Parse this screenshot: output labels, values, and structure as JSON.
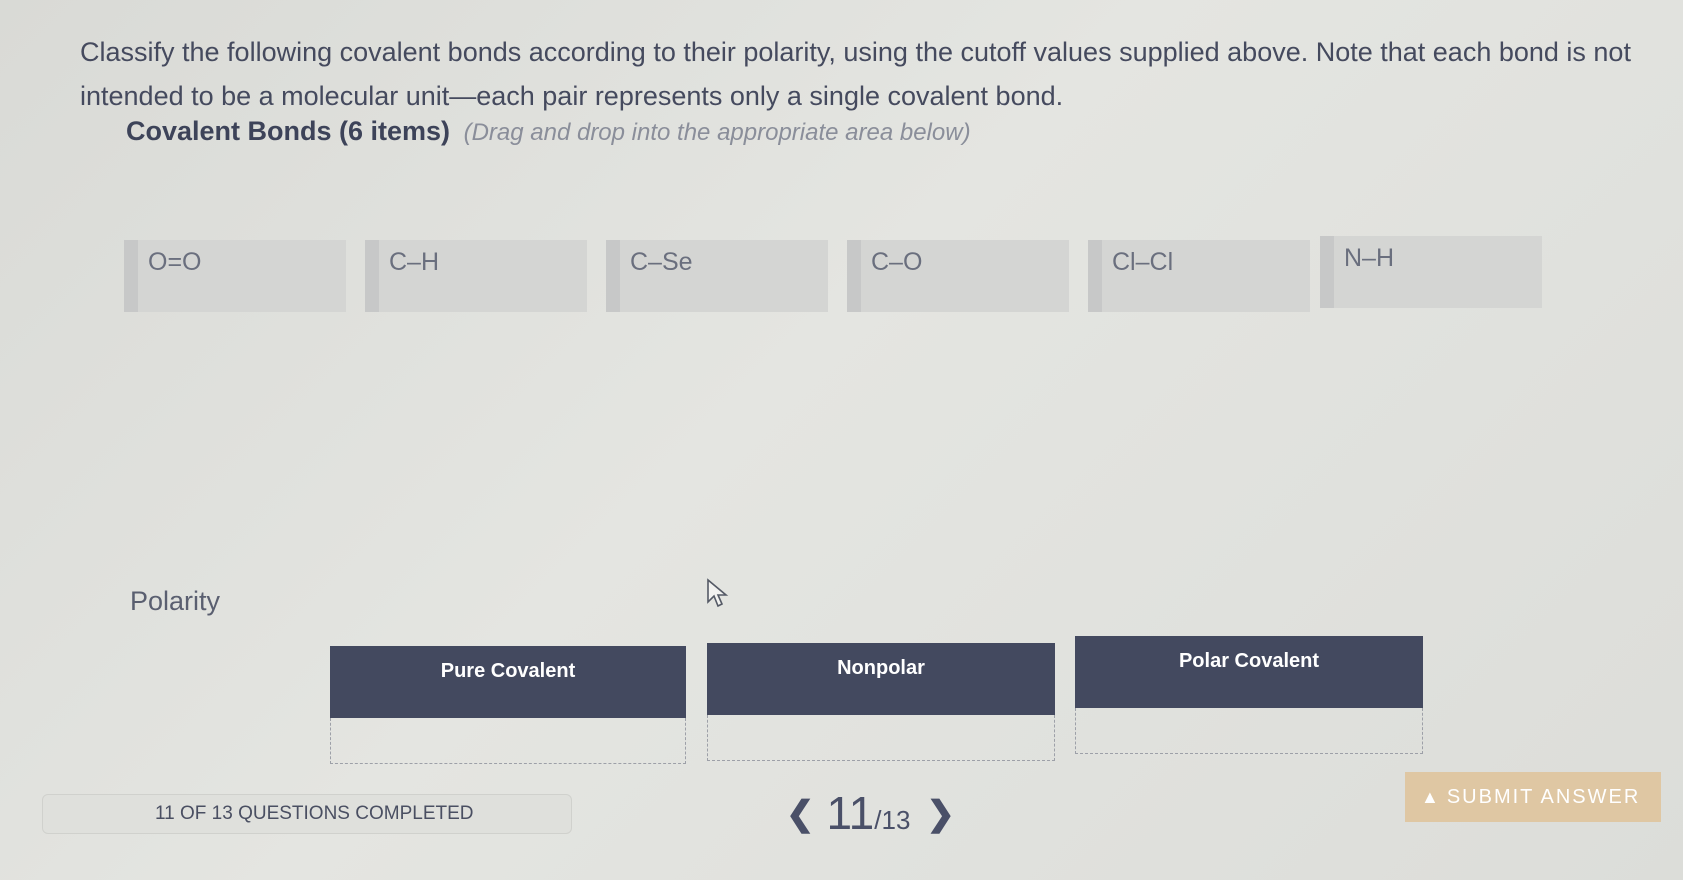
{
  "instructions": "Classify the following covalent bonds according to their polarity, using the cutoff values supplied above. Note that each bond is not intended to be a molecular unit—each pair represents only a single covalent bond.",
  "bonds_section": {
    "title": "Covalent Bonds (6 items)",
    "hint": "(Drag and drop into the appropriate area below)",
    "items": [
      "O=O",
      "C–H",
      "C–Se",
      "C–O",
      "Cl–Cl",
      "N–H"
    ]
  },
  "polarity_section": {
    "title": "Polarity",
    "bins": [
      "Pure Covalent",
      "Nonpolar",
      "Polar Covalent"
    ]
  },
  "footer": {
    "progress": "11 OF 13 QUESTIONS COMPLETED",
    "current_page": "11",
    "total_pages": "/13",
    "submit_label": "SUBMIT ANSWER"
  },
  "colors": {
    "bin_header": "#43495f",
    "submit_button": "#dfc7a3",
    "chip": "#d4d5d3"
  }
}
